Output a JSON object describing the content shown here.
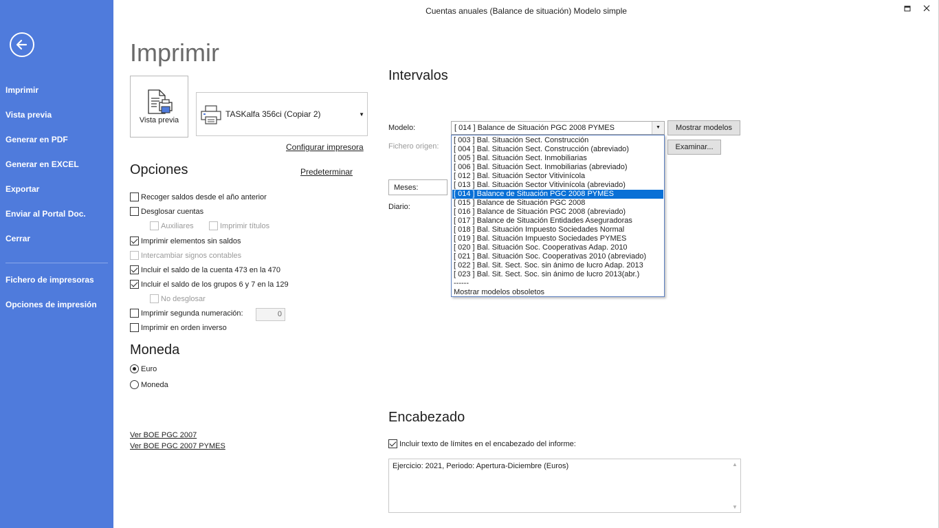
{
  "window": {
    "title": "Cuentas anuales (Balance de situación) Modelo simple"
  },
  "sidebar": {
    "items": [
      {
        "label": "Imprimir"
      },
      {
        "label": "Vista previa"
      },
      {
        "label": "Generar en PDF"
      },
      {
        "label": "Generar en EXCEL"
      },
      {
        "label": "Exportar"
      },
      {
        "label": "Enviar al Portal Doc."
      },
      {
        "label": "Cerrar"
      },
      {
        "label": "Fichero de impresoras"
      },
      {
        "label": "Opciones de impresión"
      }
    ]
  },
  "main": {
    "title": "Imprimir",
    "preview_label": "Vista previa",
    "printer": {
      "name": "TASKalfa 356ci (Copiar 2)"
    },
    "configure_printer_link": "Configurar impresora"
  },
  "options": {
    "heading": "Opciones",
    "default_link": "Predeterminar",
    "checkboxes": [
      {
        "label": "Recoger saldos desde el año anterior",
        "checked": false,
        "disabled": false
      },
      {
        "label": "Desglosar cuentas",
        "checked": false,
        "disabled": false
      },
      {
        "label": "Auxiliares",
        "checked": false,
        "disabled": true
      },
      {
        "label": "Imprimir títulos",
        "checked": false,
        "disabled": true
      },
      {
        "label": "Imprimir elementos sin saldos",
        "checked": true,
        "disabled": false
      },
      {
        "label": "Intercambiar signos contables",
        "checked": false,
        "disabled": true
      },
      {
        "label": "Incluir el saldo de la cuenta 473 en la 470",
        "checked": true,
        "disabled": false
      },
      {
        "label": "Incluir el saldo de los grupos 6 y 7 en la 129",
        "checked": true,
        "disabled": false
      },
      {
        "label": "No desglosar",
        "checked": false,
        "disabled": true
      },
      {
        "label": "Imprimir segunda numeración:",
        "checked": false,
        "disabled": false
      },
      {
        "label": "Imprimir en orden inverso",
        "checked": false,
        "disabled": false
      }
    ],
    "second_numbering_value": "0"
  },
  "currency": {
    "heading": "Moneda",
    "options": [
      {
        "label": "Euro",
        "selected": true
      },
      {
        "label": "Moneda",
        "selected": false
      }
    ]
  },
  "links": {
    "boe_pgc_2007": "Ver BOE PGC 2007",
    "boe_pgc_2007_pymes": "Ver BOE PGC 2007 PYMES"
  },
  "intervals": {
    "heading": "Intervalos",
    "model_label": "Modelo:",
    "model_value": "[ 014 ] Balance de Situación PGC 2008 PYMES",
    "show_models_button": "Mostrar modelos",
    "source_file_label": "Fichero origen:",
    "browse_button": "Examinar...",
    "months_label": "Meses:",
    "journal_label": "Diario:",
    "dropdown_items": [
      {
        "label": "[ 003 ] Bal. Situación Sect. Construcción",
        "selected": false
      },
      {
        "label": "[ 004 ] Bal. Situación Sect. Construcción (abreviado)",
        "selected": false
      },
      {
        "label": "[ 005 ] Bal. Situación Sect. Inmobiliarias",
        "selected": false
      },
      {
        "label": "[ 006 ] Bal. Situación Sect. Inmobiliarias (abreviado)",
        "selected": false
      },
      {
        "label": "[ 012 ] Bal. Situación Sector Vitivinícola",
        "selected": false
      },
      {
        "label": "[ 013 ] Bal. Situación Sector Vitivinícola (abreviado)",
        "selected": false
      },
      {
        "label": "[ 014 ] Balance de Situación PGC 2008 PYMES",
        "selected": true
      },
      {
        "label": "[ 015 ] Balance de Situación PGC 2008",
        "selected": false
      },
      {
        "label": "[ 016 ] Balance de Situación PGC 2008 (abreviado)",
        "selected": false
      },
      {
        "label": "[ 017 ] Balance de Situación Entidades Aseguradoras",
        "selected": false
      },
      {
        "label": "[ 018 ] Bal. Situación  Impuesto Sociedades Normal",
        "selected": false
      },
      {
        "label": "[ 019 ] Bal. Situación  Impuesto Sociedades PYMES",
        "selected": false
      },
      {
        "label": "[ 020 ] Bal. Situación Soc. Cooperativas Adap. 2010",
        "selected": false
      },
      {
        "label": "[ 021 ] Bal. Situación Soc. Cooperativas 2010 (abreviado)",
        "selected": false
      },
      {
        "label": "[ 022 ] Bal. Sit. Sect. Soc. sin ánimo de lucro Adap. 2013",
        "selected": false
      },
      {
        "label": "[ 023 ] Bal. Sit. Sect. Soc. sin ánimo de lucro 2013(abr.)",
        "selected": false
      },
      {
        "label": "------",
        "selected": false
      },
      {
        "label": "Mostrar modelos obsoletos",
        "selected": false
      }
    ]
  },
  "header_section": {
    "heading": "Encabezado",
    "include_limits_label": "Incluir texto de límites en el encabezado del informe:",
    "include_limits_checked": true,
    "text": "Ejercicio: 2021, Periodo: Apertura-Diciembre (Euros)"
  },
  "icons": {
    "back": "back-arrow-icon",
    "preview": "document-printer-icon",
    "printer": "printer-icon",
    "maximize": "maximize-icon",
    "close": "close-icon"
  },
  "colors": {
    "sidebar": "#4f7bdc",
    "selection": "#0a70d6"
  }
}
